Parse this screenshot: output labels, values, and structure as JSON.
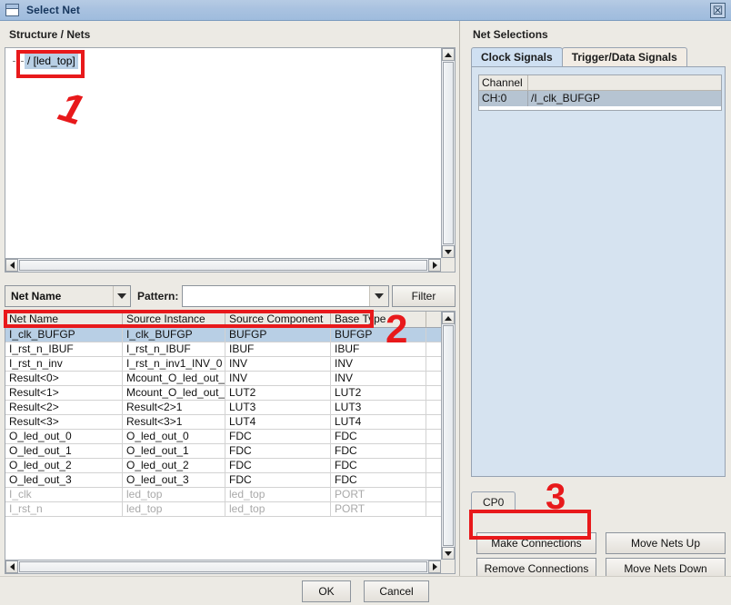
{
  "window": {
    "title": "Select Net",
    "icon": "window-icon",
    "close_label": "☒"
  },
  "left": {
    "section_title": "Structure / Nets",
    "tree": {
      "root_label": "/ [led_top]"
    },
    "filter": {
      "field_selector": "Net Name",
      "pattern_label": "Pattern:",
      "pattern_value": "",
      "pattern_placeholder": "",
      "filter_button": "Filter"
    },
    "table": {
      "columns": [
        "Net Name",
        "Source Instance",
        "Source Component",
        "Base Type"
      ],
      "rows": [
        {
          "cells": [
            "I_clk_BUFGP",
            "I_clk_BUFGP",
            "BUFGP",
            "BUFGP"
          ],
          "selected": true,
          "dim": false
        },
        {
          "cells": [
            "I_rst_n_IBUF",
            "I_rst_n_IBUF",
            "IBUF",
            "IBUF"
          ],
          "selected": false,
          "dim": false
        },
        {
          "cells": [
            "I_rst_n_inv",
            "I_rst_n_inv1_INV_0",
            "INV",
            "INV"
          ],
          "selected": false,
          "dim": false
        },
        {
          "cells": [
            "Result<0>",
            "Mcount_O_led_out_xo...",
            "INV",
            "INV"
          ],
          "selected": false,
          "dim": false
        },
        {
          "cells": [
            "Result<1>",
            "Mcount_O_led_out_xo...",
            "LUT2",
            "LUT2"
          ],
          "selected": false,
          "dim": false
        },
        {
          "cells": [
            "Result<2>",
            "Result<2>1",
            "LUT3",
            "LUT3"
          ],
          "selected": false,
          "dim": false
        },
        {
          "cells": [
            "Result<3>",
            "Result<3>1",
            "LUT4",
            "LUT4"
          ],
          "selected": false,
          "dim": false
        },
        {
          "cells": [
            "O_led_out_0",
            "O_led_out_0",
            "FDC",
            "FDC"
          ],
          "selected": false,
          "dim": false
        },
        {
          "cells": [
            "O_led_out_1",
            "O_led_out_1",
            "FDC",
            "FDC"
          ],
          "selected": false,
          "dim": false
        },
        {
          "cells": [
            "O_led_out_2",
            "O_led_out_2",
            "FDC",
            "FDC"
          ],
          "selected": false,
          "dim": false
        },
        {
          "cells": [
            "O_led_out_3",
            "O_led_out_3",
            "FDC",
            "FDC"
          ],
          "selected": false,
          "dim": false
        },
        {
          "cells": [
            "I_clk",
            "led_top",
            "led_top",
            "PORT"
          ],
          "selected": false,
          "dim": true
        },
        {
          "cells": [
            "I_rst_n",
            "led_top",
            "led_top",
            "PORT"
          ],
          "selected": false,
          "dim": true
        }
      ]
    }
  },
  "right": {
    "section_title": "Net Selections",
    "tabs": [
      {
        "label": "Clock Signals",
        "active": true
      },
      {
        "label": "Trigger/Data Signals",
        "active": false
      }
    ],
    "channel_table": {
      "columns": [
        "Channel",
        ""
      ],
      "rows": [
        {
          "cells": [
            "CH:0",
            "/I_clk_BUFGP"
          ],
          "selected": true
        }
      ]
    },
    "cp_tabs": [
      {
        "label": "CP0",
        "active": true
      }
    ],
    "buttons": [
      "Make Connections",
      "Move Nets Up",
      "Remove Connections",
      "Move Nets Down"
    ]
  },
  "dialog_buttons": {
    "ok": "OK",
    "cancel": "Cancel"
  },
  "annotations": {
    "marker_1": "1",
    "marker_2": "2",
    "marker_3": "3",
    "color": "#e8191b"
  }
}
